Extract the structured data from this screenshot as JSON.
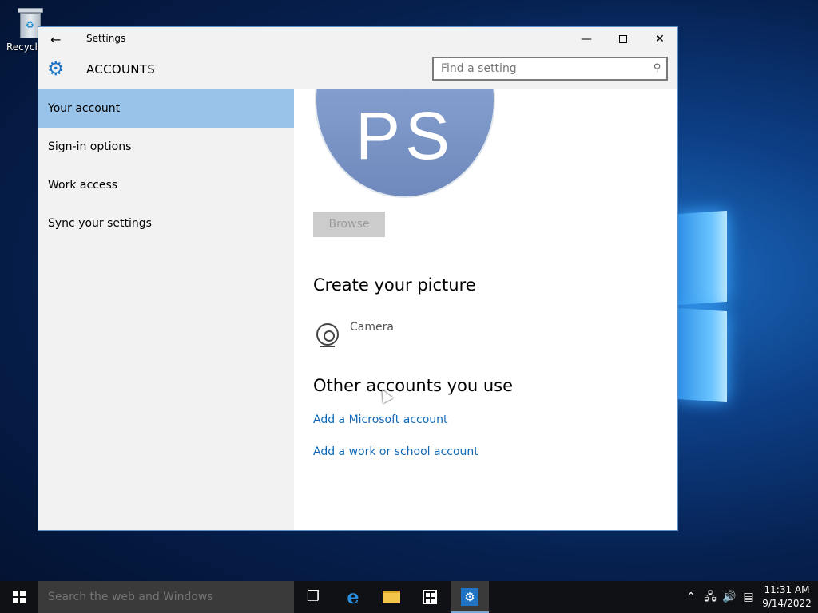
{
  "desktop": {
    "recycle_bin_label": "Recycle"
  },
  "window": {
    "title": "Settings",
    "section": "ACCOUNTS",
    "search_placeholder": "Find a setting"
  },
  "sidebar": {
    "items": [
      {
        "label": "Your account",
        "active": true
      },
      {
        "label": "Sign-in options",
        "active": false
      },
      {
        "label": "Work access",
        "active": false
      },
      {
        "label": "Sync your settings",
        "active": false
      }
    ]
  },
  "content": {
    "avatar_initials": "PS",
    "browse_label": "Browse",
    "create_picture_heading": "Create your picture",
    "camera_label": "Camera",
    "other_accounts_heading": "Other accounts you use",
    "add_microsoft_account": "Add a Microsoft account",
    "add_work_account": "Add a work or school account"
  },
  "taskbar": {
    "search_placeholder": "Search the web and Windows",
    "time": "11:31 AM",
    "date": "9/14/2022"
  },
  "colors": {
    "accent": "#1e73c4",
    "sidebar_active": "#99c3e8",
    "link": "#1068b5"
  },
  "icons": {
    "back": "back-arrow-icon",
    "gear": "gear-icon",
    "search": "search-icon",
    "camera": "camera-icon",
    "start": "windows-logo-icon",
    "task_view": "task-view-icon",
    "edge": "edge-icon",
    "file_explorer": "folder-icon",
    "store": "store-icon",
    "settings": "settings-gear-icon"
  }
}
